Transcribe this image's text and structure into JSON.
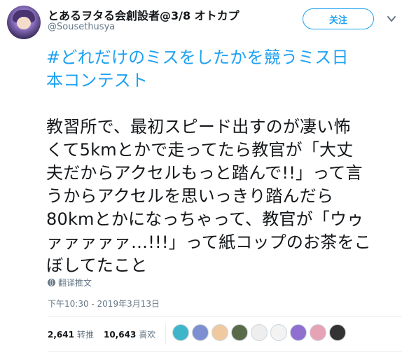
{
  "header": {
    "display_name": "とあるヲタる会創設者@3/8 オトカプ",
    "handle": "@Sousethusya",
    "follow_label": "关注",
    "avatar_icon": "user-avatar-icon",
    "caret_icon": "chevron-down-icon"
  },
  "tweet": {
    "hashtag": "#どれだけのミスをしたかを競うミス日\n本コンテスト",
    "body": "教習所で、最初スピード出すのが凄い怖\nくて5kmとかで走ってたら教官が「大丈\n夫だからアクセルもっと踏んで!!」って言\nうからアクセルを思いっきり踏んだら\n80kmとかになっちゃって、教官が「ウゥ\nァァァァァ…!!!」って紙コップのお茶をこ\nぼしてたこと",
    "translate_label": "翻译推文",
    "translate_icon": "globe-icon",
    "timestamp": "下午10:30 - 2019年3月13日"
  },
  "stats": {
    "retweets_count": "2,641",
    "retweets_label": "转推",
    "likes_count": "10,643",
    "likes_label": "喜欢"
  },
  "likers": {
    "count": 9,
    "colors": [
      "#3fb5c9",
      "#7d8fd0",
      "#f0c9a0",
      "#5a6b4a",
      "#eeeeee",
      "#f3f3f3",
      "#8f6fcf",
      "#e7a3b6",
      "#333333"
    ]
  },
  "colors": {
    "accent": "#1da1f2",
    "secondary_text": "#657786",
    "text": "#14171a"
  }
}
